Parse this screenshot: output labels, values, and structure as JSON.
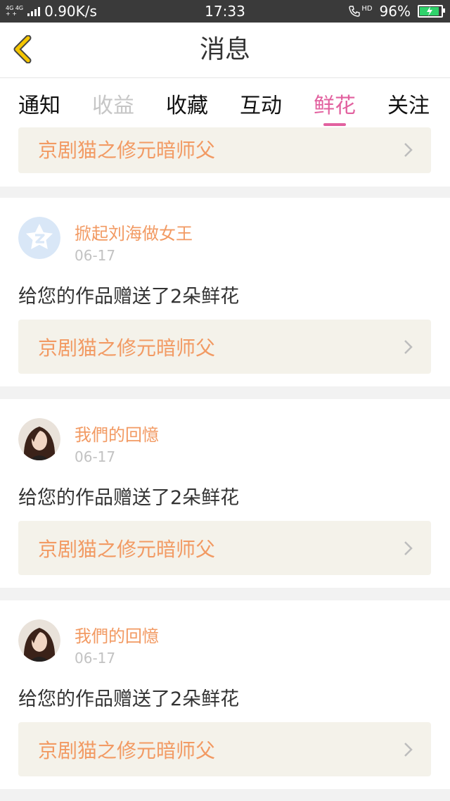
{
  "status_bar": {
    "network_top": "4G 4G",
    "network_bottom": "+ +",
    "speed": "0.90K/s",
    "time": "17:33",
    "hd": "HD",
    "battery_pct": "96%",
    "battery_level": 0.96
  },
  "header": {
    "title": "消息",
    "back_icon": "chevron-left-icon"
  },
  "tabs": [
    {
      "label": "通知"
    },
    {
      "label": "收益"
    },
    {
      "label": "收藏"
    },
    {
      "label": "互动"
    },
    {
      "label": "鲜花"
    },
    {
      "label": "关注"
    }
  ],
  "feed": {
    "partial_card": {
      "work_title": "京剧猫之修元暗师父"
    },
    "cards": [
      {
        "avatar": "app-default-avatar",
        "username": "掀起刘海做女王",
        "date": "06-17",
        "message": "给您的作品赠送了2朵鲜花",
        "work_title": "京剧猫之修元暗师父"
      },
      {
        "avatar": "user-photo-avatar",
        "username": "我們的回憶",
        "date": "06-17",
        "message": "给您的作品赠送了2朵鲜花",
        "work_title": "京剧猫之修元暗师父"
      },
      {
        "avatar": "user-photo-avatar",
        "username": "我們的回憶",
        "date": "06-17",
        "message": "给您的作品赠送了2朵鲜花",
        "work_title": "京剧猫之修元暗师父"
      }
    ]
  },
  "colors": {
    "accent_pink": "#e2619f",
    "orange_text": "#f29a63",
    "back_arrow_yellow": "#f5c600",
    "work_card_bg": "#f4f2ea"
  }
}
